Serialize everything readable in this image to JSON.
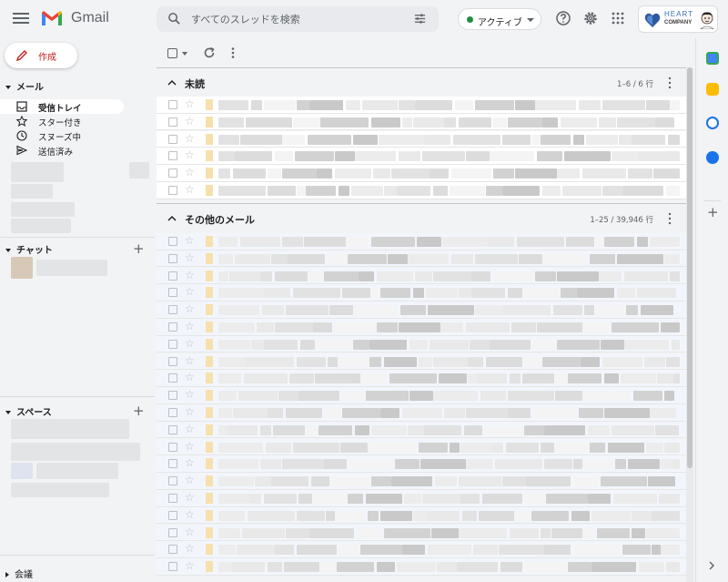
{
  "app": {
    "name": "Gmail"
  },
  "search": {
    "placeholder": "すべてのスレッドを検索"
  },
  "status": {
    "label": "アクティブ"
  },
  "company": {
    "line1": "HEART",
    "line2": "COMPANY"
  },
  "compose": {
    "label": "作成"
  },
  "sidebar": {
    "mail_section": "メール",
    "items": [
      {
        "label": "受信トレイ",
        "icon": "inbox-icon",
        "active": true
      },
      {
        "label": "スター付き",
        "icon": "star-icon"
      },
      {
        "label": "スヌーズ中",
        "icon": "clock-icon"
      },
      {
        "label": "送信済み",
        "icon": "send-icon"
      }
    ],
    "chat_section": "チャット",
    "spaces_section": "スペース",
    "meet_section": "会議"
  },
  "sections": [
    {
      "name": "未読",
      "count": "1–6 / 6 行"
    },
    {
      "name": "その他のメール",
      "count": "1–25 / 39,946 行"
    }
  ],
  "colors": {
    "accent_red": "#c5221f",
    "status_green": "#1e8e3e",
    "importance": "#f6e0ad"
  }
}
